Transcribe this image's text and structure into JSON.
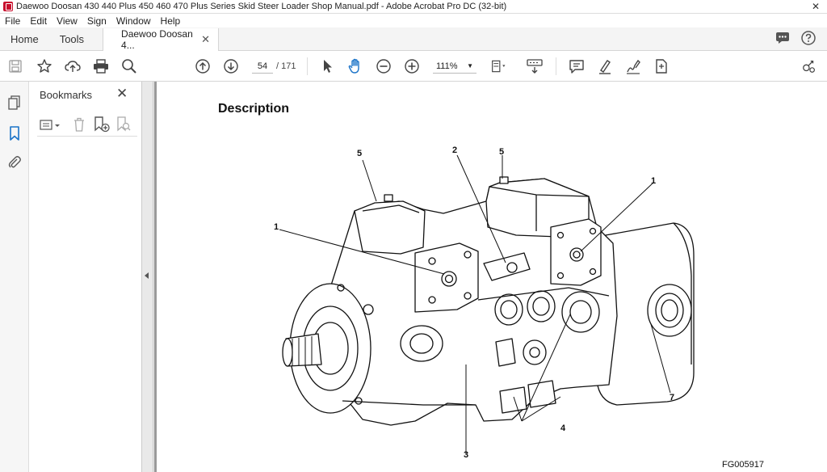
{
  "window": {
    "title": "Daewoo Doosan 430 440 Plus 450 460 470 Plus Series Skid Steer Loader Shop Manual.pdf - Adobe Acrobat Pro DC (32-bit)",
    "close_glyph": "✕"
  },
  "menu": {
    "items": [
      "File",
      "Edit",
      "View",
      "Sign",
      "Window",
      "Help"
    ]
  },
  "tabs": {
    "home": "Home",
    "tools": "Tools",
    "document": "Daewoo Doosan 4...",
    "document_close": "✕"
  },
  "toolbar": {
    "current_page": "54",
    "total_pages": "/  171",
    "zoom": "111%"
  },
  "bookmarks": {
    "title": "Bookmarks",
    "close_glyph": "✕"
  },
  "page": {
    "heading": "Description",
    "figure_code": "FG005917",
    "callouts": [
      "5",
      "2",
      "5",
      "1",
      "1",
      "7",
      "4",
      "3"
    ]
  },
  "colors": {
    "accent_blue": "#1a73c8",
    "app_red": "#c8102e",
    "viewer_bg": "#9a9a9a"
  },
  "icons": {
    "titlebar": "acrobat-app-icon",
    "toolbar": [
      "save-icon",
      "bookmark-star-icon",
      "upload-cloud-icon",
      "print-icon",
      "find-icon",
      "prev-page-icon",
      "next-page-icon",
      "select-pointer-icon",
      "hand-tool-icon",
      "zoom-out-icon",
      "zoom-in-icon",
      "page-fit-icon",
      "keyboard-icon",
      "comment-icon",
      "highlight-icon",
      "sign-icon",
      "share-file-icon",
      "share-link-icon"
    ],
    "rail": [
      "page-thumbnails-icon",
      "bookmarks-icon",
      "attachments-icon"
    ]
  }
}
